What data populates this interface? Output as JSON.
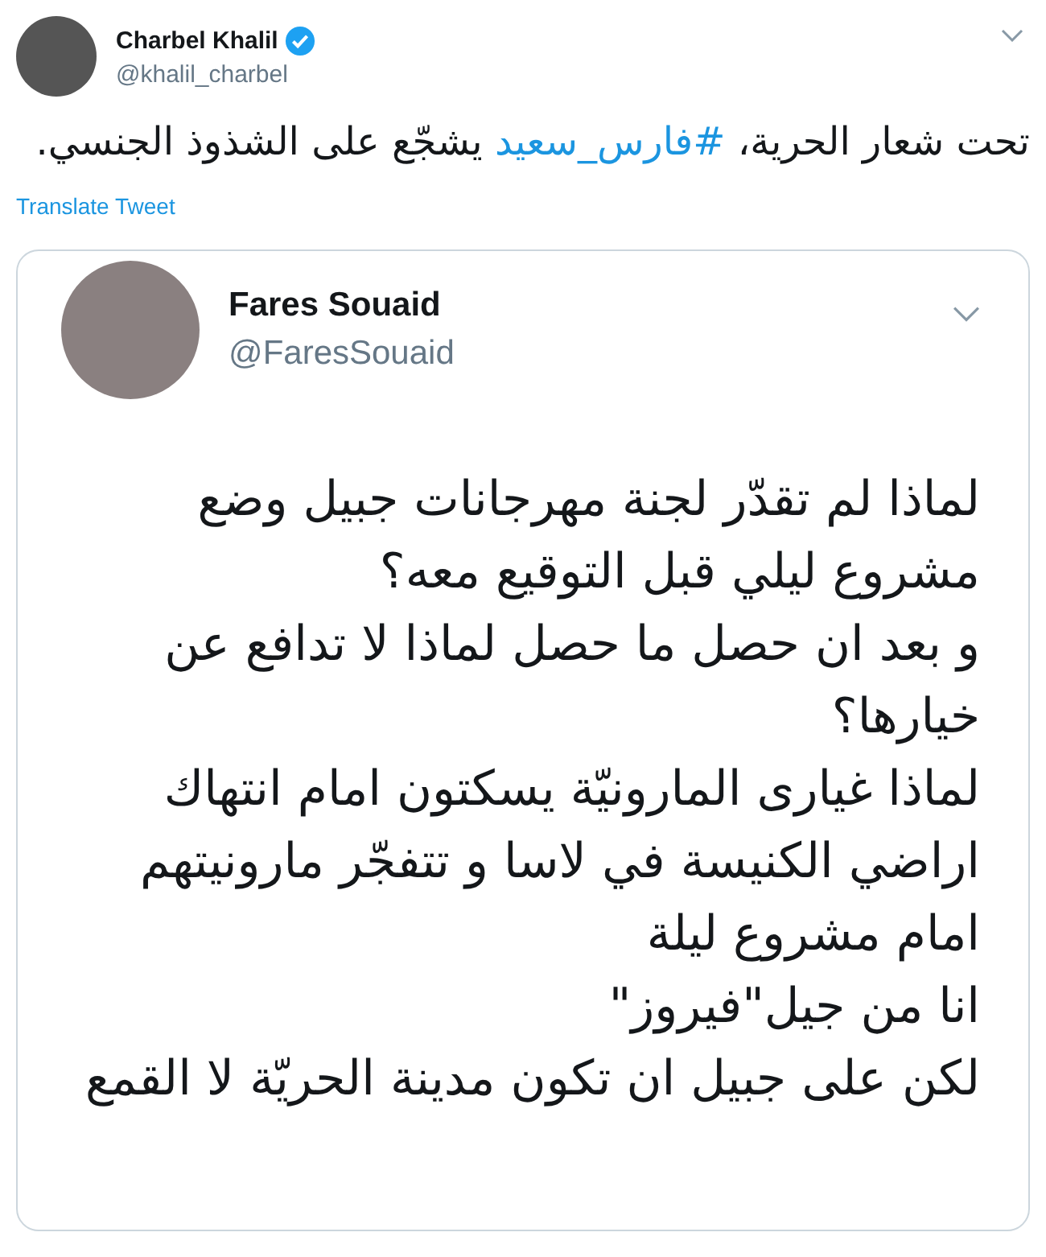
{
  "tweet": {
    "author": {
      "name": "Charbel Khalil",
      "handle": "@khalil_charbel",
      "verified": true
    },
    "text": {
      "before": "تحت شعار الحرية، ",
      "hashtag": "#فارس_سعيد",
      "after": " يشجّع على الشذوذ الجنسي."
    },
    "translate_link": "Translate Tweet",
    "quoted_tweet": {
      "author": {
        "name": "Fares Souaid",
        "handle": "@FaresSouaid"
      },
      "lines": [
        "لماذا لم تقدّر  لجنة مهرجانات جبيل وضع",
        "مشروع ليلي قبل التوقيع معه؟",
        "و بعد ان حصل ما حصل لماذا لا تدافع عن",
        "خيارها؟",
        "لماذا غيارى المارونيّة يسكتون امام انتهاك",
        "اراضي الكنيسة في لاسا و تتفجّر مارونيتهم",
        "امام مشروع ليلة",
        "انا من جيل\"فيروز\"",
        "لكن على جبيل ان تكون مدينة الحريّة لا القمع"
      ]
    }
  }
}
